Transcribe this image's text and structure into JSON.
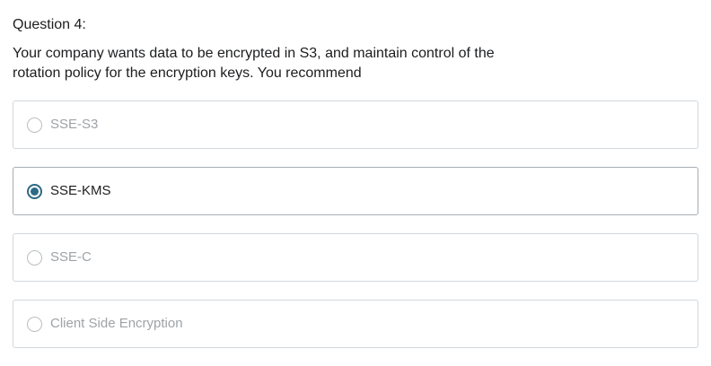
{
  "question": {
    "label": "Question 4:",
    "text": "Your company wants data to be encrypted in S3, and maintain control of the rotation policy for the encryption keys. You recommend"
  },
  "options": [
    {
      "label": "SSE-S3",
      "selected": false
    },
    {
      "label": "SSE-KMS",
      "selected": true
    },
    {
      "label": "SSE-C",
      "selected": false
    },
    {
      "label": "Client Side Encryption",
      "selected": false
    }
  ],
  "colors": {
    "accent": "#2d6a86",
    "border": "#d1d7dc",
    "text": "#1c1d1f",
    "muted_text": "#9ea3a7"
  }
}
